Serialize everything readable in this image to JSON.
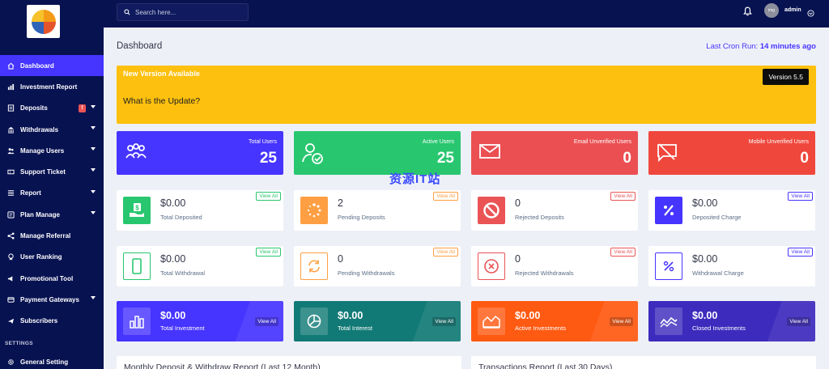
{
  "sidebar": {
    "items": [
      {
        "label": "Dashboard",
        "icon": "home-icon"
      },
      {
        "label": "Investment Report",
        "icon": "bar-chart-icon"
      },
      {
        "label": "Deposits",
        "icon": "deposit-icon",
        "badge": "!"
      },
      {
        "label": "Withdrawals",
        "icon": "bank-icon"
      },
      {
        "label": "Manage Users",
        "icon": "users-icon"
      },
      {
        "label": "Support Ticket",
        "icon": "ticket-icon"
      },
      {
        "label": "Report",
        "icon": "list-icon"
      },
      {
        "label": "Plan Manage",
        "icon": "plan-icon"
      },
      {
        "label": "Manage Referral",
        "icon": "referral-icon"
      },
      {
        "label": "User Ranking",
        "icon": "ranking-icon"
      },
      {
        "label": "Promotional Tool",
        "icon": "promo-icon"
      },
      {
        "label": "Payment Gateways",
        "icon": "gateway-icon"
      },
      {
        "label": "Subscribers",
        "icon": "subscribers-icon"
      }
    ],
    "settings_title": "SETTINGS",
    "general_setting": "General Setting"
  },
  "topbar": {
    "search_placeholder": "Search here...",
    "admin_name": "admin",
    "avatar_text": "img"
  },
  "page": {
    "title": "Dashboard",
    "cron_label": "Last Cron Run:",
    "cron_value": "14 minutes ago"
  },
  "banner": {
    "title": "New Version Available",
    "version": "Version 5.5",
    "question": "What is the Update?"
  },
  "stats": [
    {
      "label": "Total Users",
      "value": "25",
      "color": "#4634ff"
    },
    {
      "label": "Active Users",
      "value": "25",
      "color": "#28c76f"
    },
    {
      "label": "Email Unverified Users",
      "value": "0",
      "color": "#eb4f52"
    },
    {
      "label": "Mobile Unverified Users",
      "value": "0",
      "color": "#f0473c"
    }
  ],
  "cards_row2": [
    {
      "amount": "$0.00",
      "label": "Total Deposited",
      "view": "View All",
      "color": "#28c76f"
    },
    {
      "amount": "2",
      "label": "Pending Deposits",
      "view": "View All",
      "color": "#ff9f43"
    },
    {
      "amount": "0",
      "label": "Rejected Deposits",
      "view": "View All",
      "color": "#ea5455"
    },
    {
      "amount": "$0.00",
      "label": "Deposited Charge",
      "view": "View All",
      "color": "#4634ff"
    }
  ],
  "cards_row3": [
    {
      "amount": "$0.00",
      "label": "Total Withdrawal",
      "view": "View All",
      "color": "#28c76f"
    },
    {
      "amount": "0",
      "label": "Pending Withdrawals",
      "view": "View All",
      "color": "#ff9f43"
    },
    {
      "amount": "0",
      "label": "Rejected Withdrawals",
      "view": "View All",
      "color": "#ea5455"
    },
    {
      "amount": "$0.00",
      "label": "Withdrawal Charge",
      "view": "View All",
      "color": "#4634ff"
    }
  ],
  "cards_row4": [
    {
      "amount": "$0.00",
      "label": "Total Investment",
      "view": "View All",
      "color": "#4634ff"
    },
    {
      "amount": "$0.00",
      "label": "Total Interest",
      "view": "View All",
      "color": "#127a76"
    },
    {
      "amount": "$0.00",
      "label": "Active Investments",
      "view": "View All",
      "color": "#ff5a12"
    },
    {
      "amount": "$0.00",
      "label": "Closed Investments",
      "view": "View All",
      "color": "#3d2bbd"
    }
  ],
  "panels": {
    "left_title": "Monthly Deposit & Withdraw Report (Last 12 Month)",
    "right_title": "Transactions Report (Last 30 Days)"
  },
  "watermark": "资源IT站"
}
